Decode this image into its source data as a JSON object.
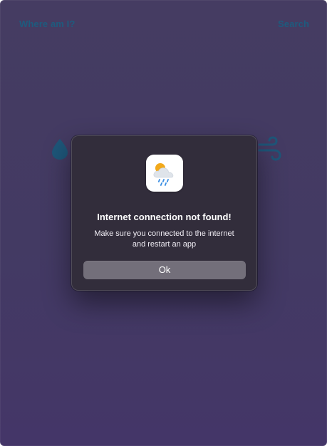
{
  "app": {
    "header": {
      "location_label": "Where am I?",
      "search_label": "Search"
    },
    "background_icons": {
      "left": "raindrop-icon",
      "right": "wind-icon"
    }
  },
  "dialog": {
    "icon": "weather-app-icon",
    "title": "Internet connection not found!",
    "message_line_1": "Make sure you connected to the internet",
    "message_line_2": "and restart an app",
    "button_label": "Ok"
  },
  "colors": {
    "background": "#463d66",
    "header_link": "#1f5d80",
    "dialog_background": "#322d3b",
    "button_background": "#736f7a",
    "icon_sun": "#f2a91b",
    "icon_cloud": "#dfe4ea",
    "icon_rain": "#3b8fe3"
  }
}
